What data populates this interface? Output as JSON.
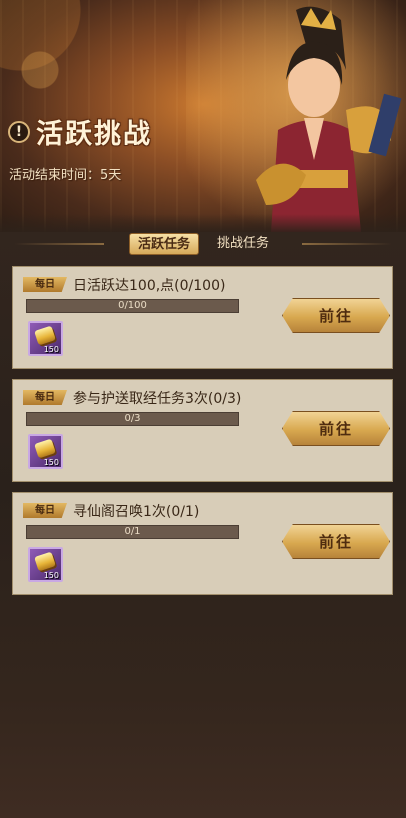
{
  "header": {
    "alert_glyph": "!",
    "title": "活跃挑战",
    "subtitle": "活动结束时间：5天"
  },
  "tabs": [
    {
      "label": "活跃任务",
      "active": true
    },
    {
      "label": "挑战任务",
      "active": false
    }
  ],
  "tasks": [
    {
      "tag": "每日",
      "name": "日活跃达100,点(0/100)",
      "progress_text": "0/100",
      "progress_fraction": 0,
      "reward_icon": "gold-ingot-icon",
      "reward_count": "150",
      "button_label": "前往"
    },
    {
      "tag": "每日",
      "name": "参与护送取经任务3次(0/3)",
      "progress_text": "0/3",
      "progress_fraction": 0,
      "reward_icon": "gold-ingot-icon",
      "reward_count": "150",
      "button_label": "前往"
    },
    {
      "tag": "每日",
      "name": "寻仙阁召唤1次(0/1)",
      "progress_text": "0/1",
      "progress_fraction": 0,
      "reward_icon": "gold-ingot-icon",
      "reward_count": "150",
      "button_label": "前往"
    }
  ],
  "colors": {
    "accent_gold": "#d8a84f",
    "card_bg": "#d8cdb8",
    "reward_purple": "#8f5bb6"
  }
}
